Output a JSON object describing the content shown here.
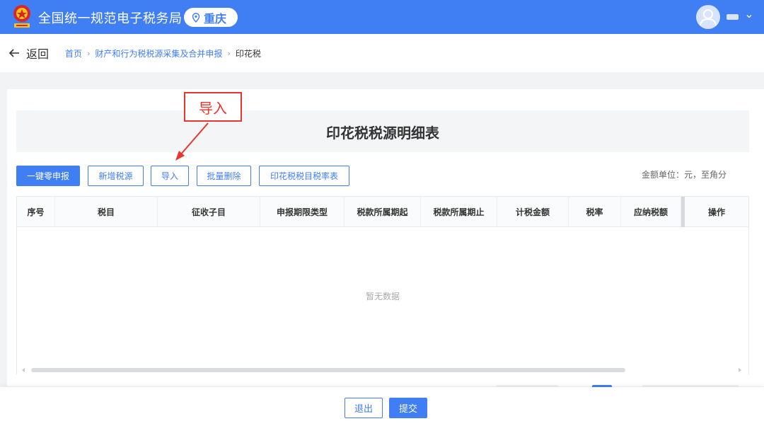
{
  "header": {
    "app_title": "全国统一规范电子税务局",
    "region": "重庆",
    "brand_color": "#3f7ef3"
  },
  "nav": {
    "back_label": "返回",
    "breadcrumbs": [
      "首页",
      "财产和行为税税源采集及合并申报",
      "印花税"
    ]
  },
  "main": {
    "table_title": "印花税税源明细表",
    "toolbar": {
      "zero_report": "一键零申报",
      "add_source": "新增税源",
      "import": "导入",
      "batch_delete": "批量删除",
      "rate_table": "印花税税目税率表"
    },
    "unit_note": "金额单位：元，至角分",
    "columns": [
      "序号",
      "税目",
      "征收子目",
      "申报期限类型",
      "税款所属期起",
      "税款所属期止",
      "计税金额",
      "税率",
      "应纳税额",
      "操作"
    ],
    "empty_text": "暂无数据"
  },
  "annotation": {
    "label": "导入",
    "color": "#e8352e"
  },
  "footer": {
    "exit_label": "退出",
    "submit_label": "提交"
  }
}
